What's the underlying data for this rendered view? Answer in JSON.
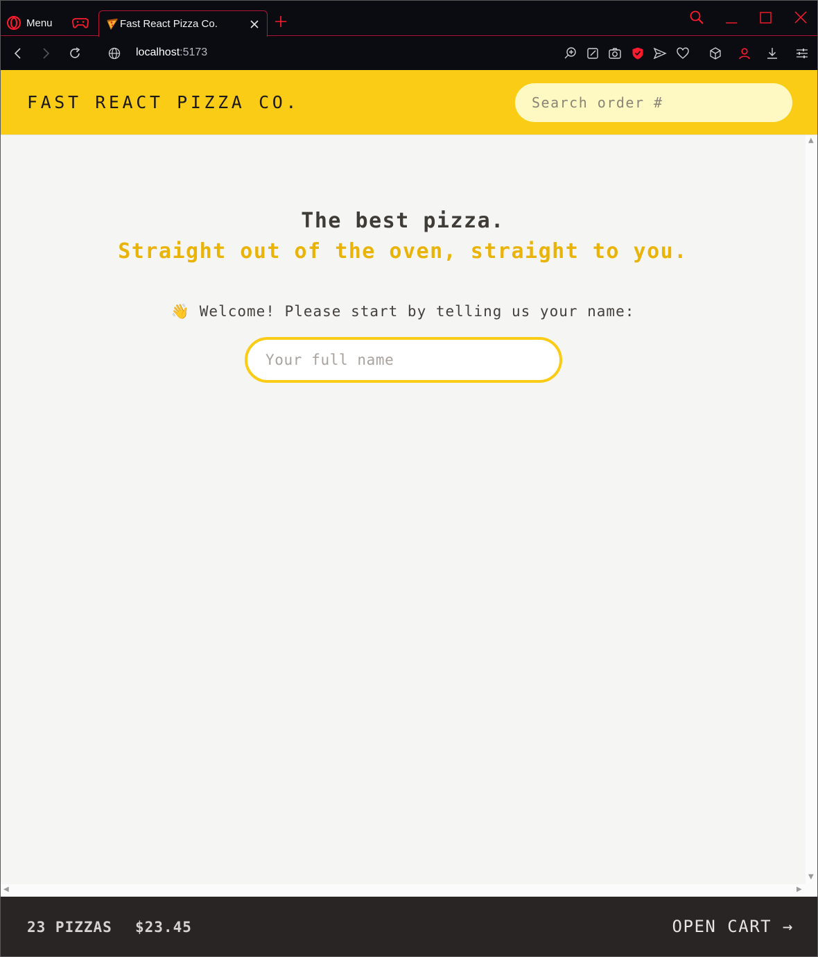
{
  "browser": {
    "menu_label": "Menu",
    "tab_title": "Fast React Pizza Co.",
    "url_host": "localhost",
    "url_port": ":5173",
    "accent_color": "#ff1b2d",
    "icons": [
      "opera-logo-icon",
      "gamepad-icon",
      "pizza-favicon-icon",
      "close-icon",
      "plus-icon",
      "search-icon",
      "minimize-icon",
      "maximize-icon",
      "close-window-icon",
      "back-icon",
      "forward-icon",
      "reload-icon",
      "globe-icon",
      "zoom-icon",
      "snapshot-edit-icon",
      "camera-icon",
      "shield-icon",
      "send-icon",
      "heart-icon",
      "cube-icon",
      "account-icon",
      "download-icon",
      "settings-icon"
    ]
  },
  "header": {
    "logo": "Fast React Pizza Co.",
    "search_placeholder": "Search order #",
    "background_color": "#facc15"
  },
  "home": {
    "title_line1": "The best pizza.",
    "title_line2": "Straight out of the oven, straight to you.",
    "welcome_emoji": "👋",
    "welcome_text": "Welcome! Please start by telling us your name:",
    "name_placeholder": "Your full name"
  },
  "cart": {
    "pizza_count": "23 pizzas",
    "total_price": "$23.45",
    "open_cart_label": "Open cart →"
  }
}
